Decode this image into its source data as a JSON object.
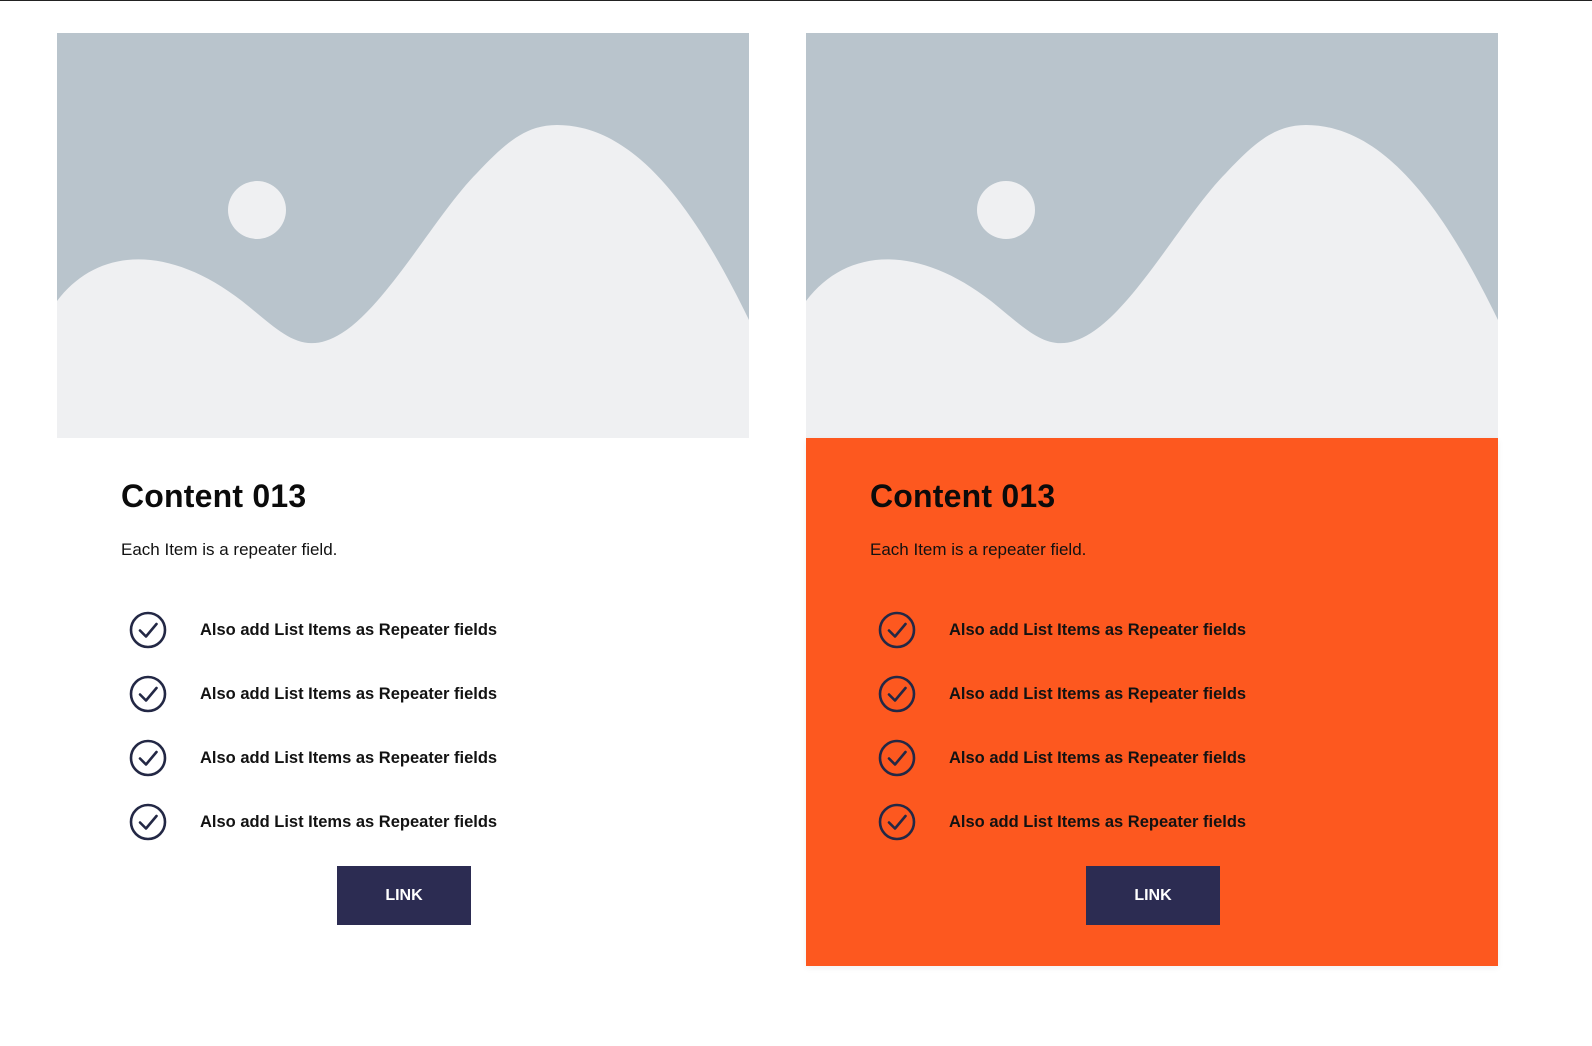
{
  "colors": {
    "accent_background": "#fd581f",
    "button_background": "#2c2c52",
    "button_text": "#ffffff",
    "icon_stroke": "#232845",
    "placeholder_sky": "#b9c4cc",
    "placeholder_ground": "#eff0f2"
  },
  "cards": [
    {
      "variant": "white",
      "image_icon": "image-placeholder-icon",
      "title": "Content 013",
      "subtitle": "Each Item is a repeater field.",
      "items": [
        {
          "icon": "check-circle-icon",
          "label": "Also add List Items as Repeater fields"
        },
        {
          "icon": "check-circle-icon",
          "label": "Also add List Items as Repeater fields"
        },
        {
          "icon": "check-circle-icon",
          "label": "Also add List Items as Repeater fields"
        },
        {
          "icon": "check-circle-icon",
          "label": "Also add List Items as Repeater fields"
        }
      ],
      "button_label": "LINK"
    },
    {
      "variant": "orange",
      "image_icon": "image-placeholder-icon",
      "title": "Content 013",
      "subtitle": "Each Item is a repeater field.",
      "items": [
        {
          "icon": "check-circle-icon",
          "label": "Also add List Items as Repeater fields"
        },
        {
          "icon": "check-circle-icon",
          "label": "Also add List Items as Repeater fields"
        },
        {
          "icon": "check-circle-icon",
          "label": "Also add List Items as Repeater fields"
        },
        {
          "icon": "check-circle-icon",
          "label": "Also add List Items as Repeater fields"
        }
      ],
      "button_label": "LINK"
    }
  ]
}
